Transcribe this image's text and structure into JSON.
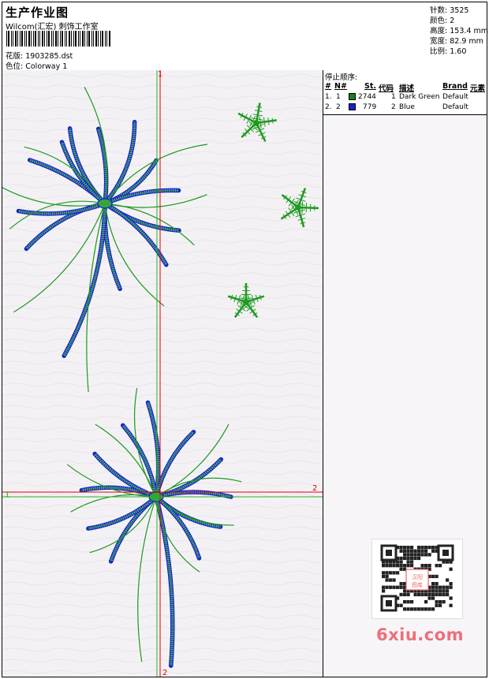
{
  "header": {
    "title": "生产作业图",
    "company": "Wilcom(汇宏) 刺饰工作室",
    "design_label": "花版:",
    "design_file": "1903285.dst",
    "colorway_label": "色位:",
    "colorway": "Colorway 1"
  },
  "stats": {
    "stitches_label": "针数:",
    "stitches": "3525",
    "colors_label": "颜色:",
    "colors": "2",
    "height_label": "高度:",
    "height": "153.4 mm",
    "width_label": "宽度:",
    "width": "82.9 mm",
    "scale_label": "比例:",
    "scale": "1.60"
  },
  "stop_sequence": {
    "title": "停止顺序:",
    "headers": [
      "#",
      "N#",
      "St.",
      "代码",
      "描述",
      "Brand",
      "元素"
    ],
    "rows": [
      {
        "index": "1.",
        "n": "1",
        "stitches": "2744",
        "code": "1",
        "desc": "Dark Green",
        "brand": "Default",
        "color": "#1e7d1e"
      },
      {
        "index": "2.",
        "n": "2",
        "stitches": "779",
        "code": "2",
        "desc": "Blue",
        "brand": "Default",
        "color": "#1424c8"
      }
    ]
  },
  "axes": {
    "x_start": "1",
    "x_end": "2",
    "y_start": "1",
    "y_end": "2"
  },
  "watermark": {
    "logo_text": "6xiu.com",
    "qr_caption": "汉阳图库"
  },
  "thread_colors": {
    "green": "#1e9a1e",
    "blue": "#1424c8",
    "axis_red": "#e00000",
    "axis_green": "#22b422"
  }
}
